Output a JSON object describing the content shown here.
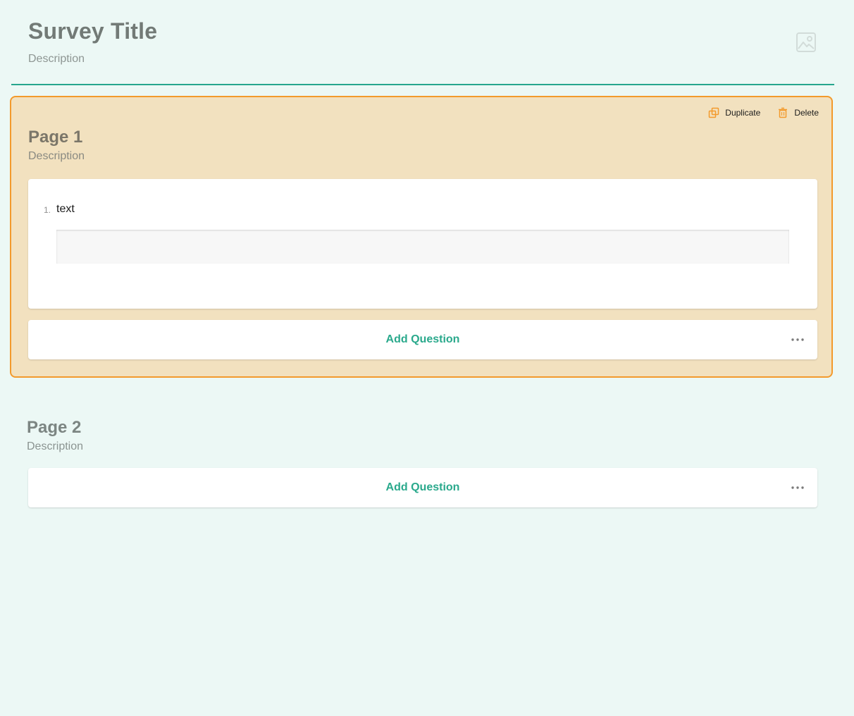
{
  "survey": {
    "title": "Survey Title",
    "description": "Description"
  },
  "colors": {
    "accent": "#26a68d",
    "selected_border": "#f39a2c",
    "selected_background": "#f2e1bf",
    "background": "#ecf8f5"
  },
  "icons": {
    "logo": "image-placeholder-icon",
    "duplicate": "duplicate-icon",
    "delete": "trash-icon",
    "more": "ellipsis-icon"
  },
  "pages": [
    {
      "title": "Page 1",
      "description": "Description",
      "selected": true,
      "actions": {
        "duplicate_label": "Duplicate",
        "delete_label": "Delete"
      },
      "questions": [
        {
          "number": "1.",
          "title": "text",
          "value": ""
        }
      ],
      "add_question_label": "Add Question"
    },
    {
      "title": "Page 2",
      "description": "Description",
      "selected": false,
      "questions": [],
      "add_question_label": "Add Question"
    }
  ]
}
